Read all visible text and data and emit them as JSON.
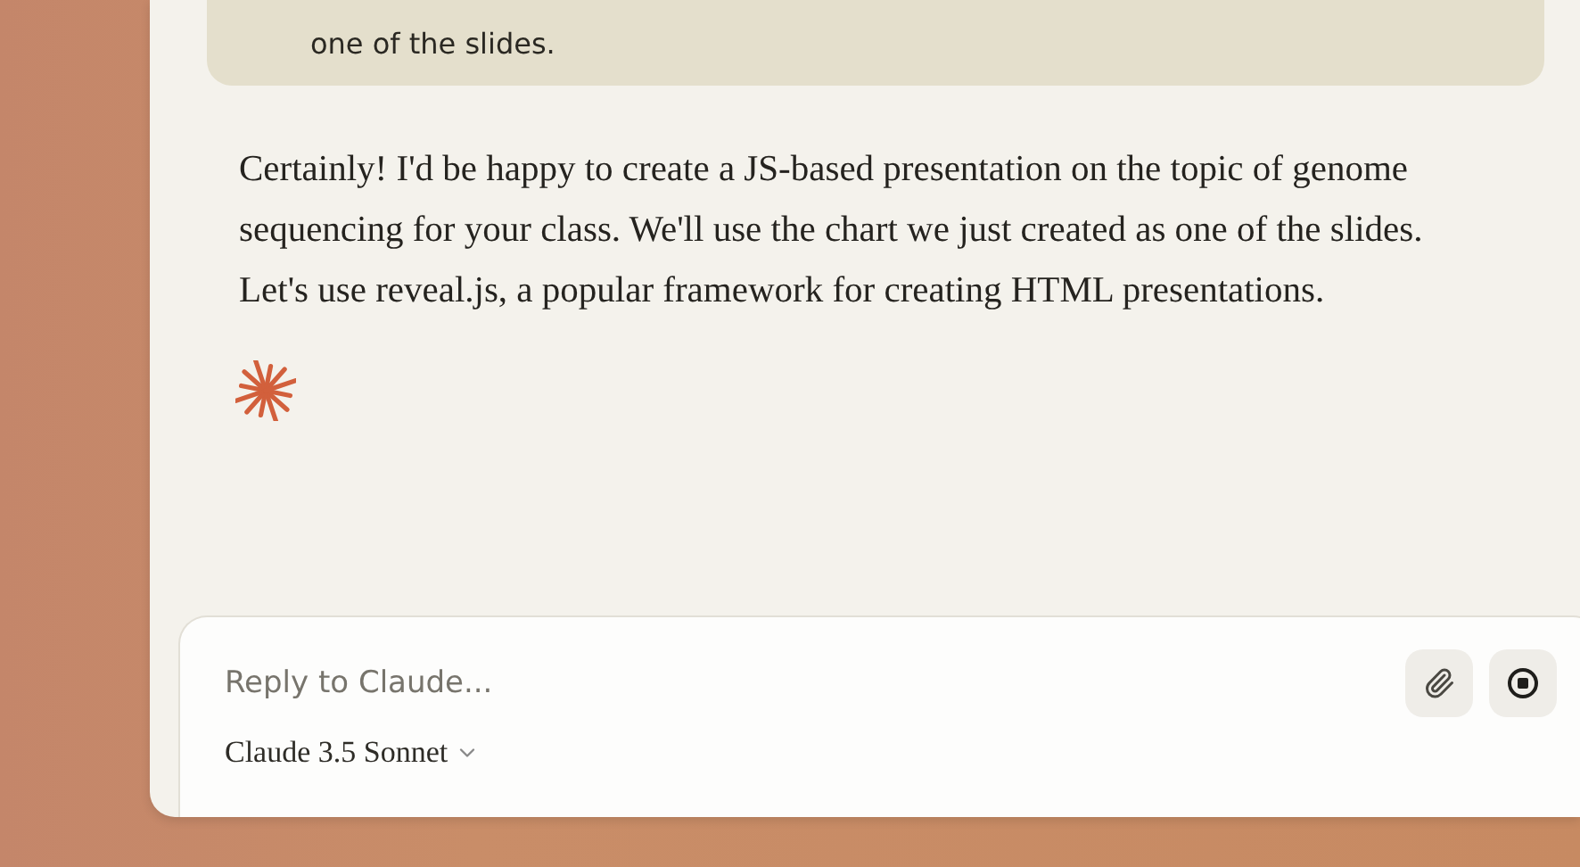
{
  "user_message": {
    "text": "one of the slides."
  },
  "assistant_message": {
    "text": "Certainly! I'd be happy to create a JS-based presentation on the topic of genome sequencing for your class. We'll use the chart we just created as one of the slides. Let's use reveal.js, a popular framework for creating HTML presentations."
  },
  "composer": {
    "placeholder": "Reply to Claude...",
    "model": "Claude 3.5 Sonnet"
  }
}
